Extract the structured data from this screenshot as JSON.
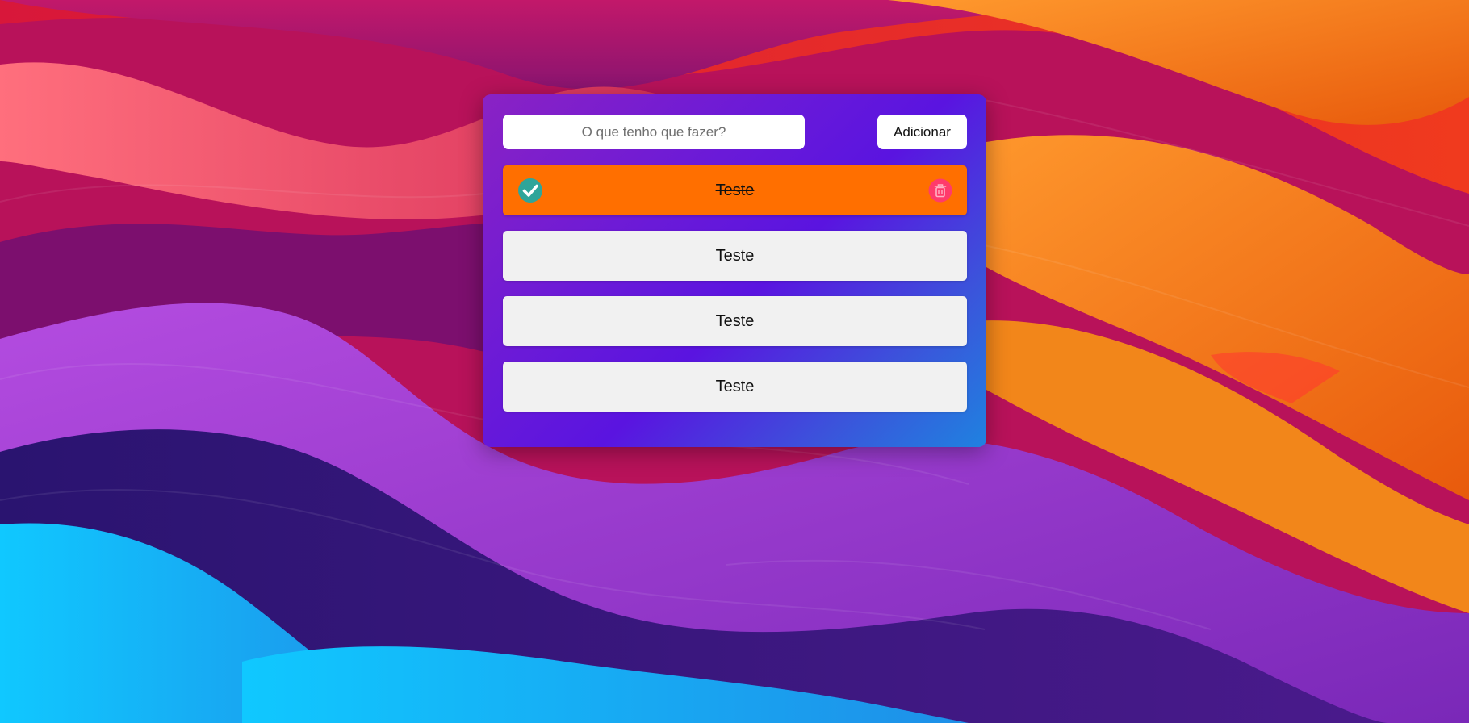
{
  "todo": {
    "input": {
      "placeholder": "O que tenho que fazer?",
      "value": ""
    },
    "add_button_label": "Adicionar",
    "tasks": [
      {
        "text": "Teste",
        "completed": true
      },
      {
        "text": "Teste",
        "completed": false
      },
      {
        "text": "Teste",
        "completed": false
      },
      {
        "text": "Teste",
        "completed": false
      }
    ]
  },
  "icons": {
    "complete": "check-circle-icon",
    "delete": "trash-icon"
  },
  "colors": {
    "completed_task": "#ff6f00",
    "pending_task": "#f1f1f1",
    "check_icon": "#2fa59a",
    "delete_icon": "#ff3b6b",
    "card_gradient_start": "#8a22c4",
    "card_gradient_end": "#1f82e0"
  }
}
